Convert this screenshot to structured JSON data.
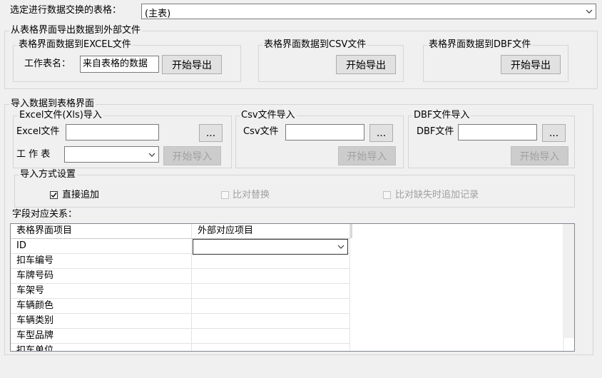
{
  "top": {
    "label": "选定进行数据交换的表格：",
    "selected": "(主表)"
  },
  "export": {
    "title": "从表格界面导出数据到外部文件",
    "excel": {
      "title": "表格界面数据到EXCEL文件",
      "sheet_label": "工作表名：",
      "sheet_value": "来自表格的数据",
      "button": "开始导出"
    },
    "csv": {
      "title": "表格界面数据到CSV文件",
      "button": "开始导出"
    },
    "dbf": {
      "title": "表格界面数据到DBF文件",
      "button": "开始导出"
    }
  },
  "import": {
    "title": "导入数据到表格界面",
    "excel": {
      "title": "Excel文件(Xls)导入",
      "file_label": "Excel文件",
      "browse": "...",
      "sheet_label": "工  作  表",
      "button": "开始导入"
    },
    "csv": {
      "title": "Csv文件导入",
      "file_label": "Csv文件",
      "browse": "...",
      "button": "开始导入"
    },
    "dbf": {
      "title": "DBF文件导入",
      "file_label": "DBF文件",
      "browse": "...",
      "button": "开始导入"
    },
    "mode": {
      "title": "导入方式设置",
      "options": [
        {
          "label": "直接追加",
          "checked": true,
          "enabled": true
        },
        {
          "label": "比对替换",
          "checked": false,
          "enabled": false
        },
        {
          "label": "比对缺失时追加记录",
          "checked": false,
          "enabled": false
        }
      ]
    },
    "mapping": {
      "label": "字段对应关系：",
      "headers": [
        "表格界面项目",
        "外部对应项目"
      ],
      "rows": [
        "ID",
        "扣车编号",
        "车牌号码",
        "车架号",
        "车辆颜色",
        "车辆类别",
        "车型品牌",
        "扣车单位"
      ]
    }
  },
  "colors": {
    "disabled_text": "#a0a0a0",
    "border": "#d5d5d5",
    "window_bg": "#f0f0f0"
  }
}
